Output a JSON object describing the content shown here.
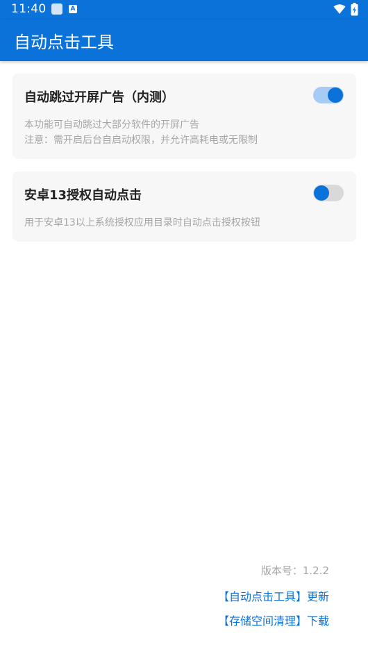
{
  "status_bar": {
    "time": "11:40",
    "icons": [
      "square-icon",
      "a-icon",
      "wifi-icon",
      "battery-icon"
    ],
    "color": "#0b72d9"
  },
  "app_bar": {
    "title": "自动点击工具"
  },
  "features": [
    {
      "title": "自动跳过开屏广告（内测）",
      "desc_line1": "本功能可自动跳过大部分软件的开屏广告",
      "desc_line2": "注意：需开启后台自启动权限，并允许高耗电或无限制",
      "enabled": true
    },
    {
      "title": "安卓13授权自动点击",
      "desc_line1": "用于安卓13以上系统授权应用目录时自动点击授权按钮",
      "enabled": false
    }
  ],
  "footer": {
    "version": "版本号：1.2.2",
    "link_update": "【自动点击工具】更新",
    "link_download": "【存储空间清理】下载"
  },
  "colors": {
    "accent": "#0b72d9",
    "switch_track_on": "#a7cbf4",
    "switch_track_off": "#d9d9d9",
    "card_bg": "#f7f7f7",
    "muted_text": "#a6a6a6"
  }
}
